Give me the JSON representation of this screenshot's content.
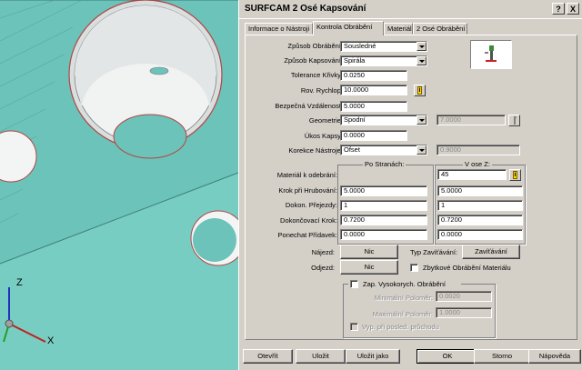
{
  "window": {
    "title": "SURFCAM 2 Osé Kapsování",
    "help_btn": "?",
    "close_btn": "X"
  },
  "tabs": [
    {
      "label": "Informace o Nástroji"
    },
    {
      "label": "Kontrola Obrábění"
    },
    {
      "label": "Materiál"
    },
    {
      "label": "2 Osé Obrábění"
    }
  ],
  "form": {
    "zpusob_obrabeni": {
      "label": "Způsob Obrábění:",
      "value": "Sousledné"
    },
    "zpusob_kapsovani": {
      "label": "Způsob Kapsování:",
      "value": "Spirála"
    },
    "tolerance_krivky": {
      "label": "Tolerance Křivky:",
      "value": "0.0250"
    },
    "rov_rychlop": {
      "label": "Rov. Rychlop:",
      "value": "10.0000"
    },
    "bezpecna_vzdalenost": {
      "label": "Bezpečná Vzdálenost:",
      "value": "5.0000"
    },
    "geometrie": {
      "label": "Geometrie:",
      "value": "Spodní",
      "extra": "7.0000"
    },
    "ukos_kapsy": {
      "label": "Úkos Kapsy:",
      "value": "0.0000"
    },
    "korekce_nastroje": {
      "label": "Korekce Nástroje:",
      "value": "Ofset",
      "extra": "0.9000"
    }
  },
  "passes": {
    "col_stranach": "Po Stranách:",
    "col_osa_z": "V ose Z:",
    "rows": [
      {
        "label": "Materiál k odebrání:",
        "side": "",
        "z": "45"
      },
      {
        "label": "Krok při Hrubování:",
        "side": "5.0000",
        "z": "5.0000"
      },
      {
        "label": "Dokon. Přejezdy:",
        "side": "1",
        "z": "1"
      },
      {
        "label": "Dokončovací Krok:",
        "side": "0.7200",
        "z": "0.7200"
      },
      {
        "label": "Ponechat Přídavek:",
        "side": "0.0000",
        "z": "0.0000"
      }
    ]
  },
  "entry": {
    "najezd_label": "Nájezd:",
    "najezd_btn": "Nic",
    "odjezd_label": "Odjezd:",
    "odjezd_btn": "Nic",
    "typ_zavitani_label": "Typ Zavíťávání:",
    "typ_zavitani_btn": "Zavíťávání",
    "zbytkove": "Zbytkové Obrábění Materiálu"
  },
  "hsm": {
    "checkbox_label": "Zap. Vysokorych. Obrábění",
    "min_polomer_label": "Minimální Poloměr:",
    "min_polomer": "0.0020",
    "max_polomer_label": "Maximální Poloměr:",
    "max_polomer": "1.0000",
    "vyp_label": "Vyp. při posled. průchodu"
  },
  "buttons": {
    "open": "Otevřít",
    "save": "Uložit",
    "save_as": "Uložit jako",
    "ok": "OK",
    "cancel": "Storno",
    "help": "Nápověda"
  },
  "axes": {
    "x": "X",
    "z": "Z"
  },
  "colors": {
    "model_face": "#6cc3b9",
    "hole_edge": "#b24545",
    "dialog_bg": "#d4d0c8"
  }
}
